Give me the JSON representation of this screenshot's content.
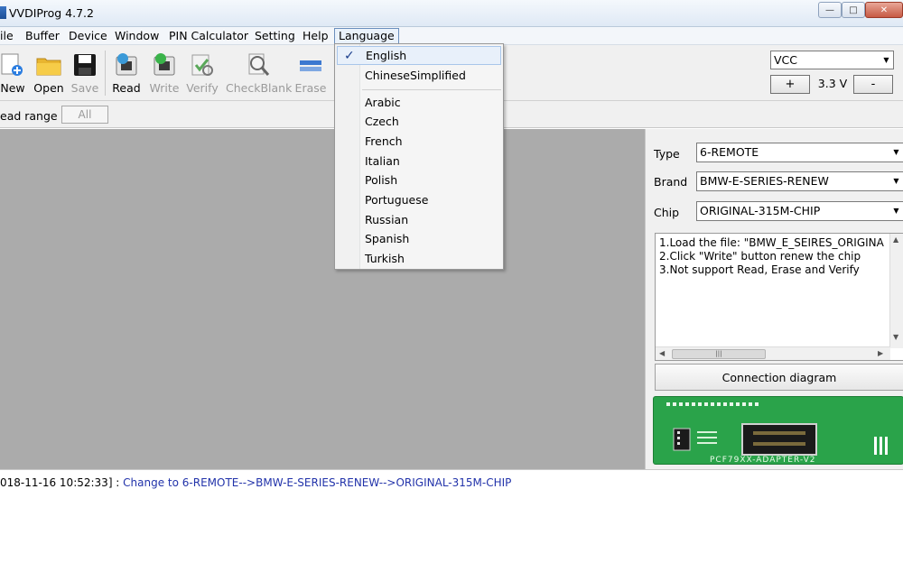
{
  "window": {
    "title": "VVDIProg 4.7.2",
    "min_glyph": "—",
    "max_glyph": "□",
    "close_glyph": "✕"
  },
  "menu": [
    "ile",
    "Buffer",
    "Device",
    "Window",
    "PIN Calculator",
    "Setting",
    "Help",
    "Language"
  ],
  "toolbar": {
    "new": "New",
    "open": "Open",
    "save": "Save",
    "read": "Read",
    "write": "Write",
    "verify": "Verify",
    "check_blank": "CheckBlank",
    "erase": "Erase"
  },
  "vcc": {
    "selected": "VCC",
    "plus": "+",
    "value": "3.3 V",
    "minus": "-"
  },
  "range": {
    "label": "ead range",
    "value": "All"
  },
  "config": {
    "type_label": "Type",
    "type_value": "6-REMOTE",
    "brand_label": "Brand",
    "brand_value": "BMW-E-SERIES-RENEW",
    "chip_label": "Chip",
    "chip_value": "ORIGINAL-315M-CHIP"
  },
  "notes": [
    "1.Load the file: \"BMW_E_SEIRES_ORIGINA",
    "2.Click \"Write\" button renew the chip",
    "3.Not support Read, Erase and Verify"
  ],
  "connection_button": "Connection diagram",
  "board_label": "PCF79XX-ADAPTER-V2",
  "log": {
    "time": "018-11-16 10:52:33] : ",
    "message": "Change to 6-REMOTE-->BMW-E-SERIES-RENEW-->ORIGINAL-315M-CHIP"
  },
  "language_menu": {
    "check": "✓",
    "top": [
      "English",
      "ChineseSimplified"
    ],
    "others": [
      "Arabic",
      "Czech",
      "French",
      "Italian",
      "Polish",
      "Portuguese",
      "Russian",
      "Spanish",
      "Turkish"
    ]
  },
  "colors": {
    "workspace": "#ababab",
    "board_green": "#2aa34a",
    "log_blue": "#2233aa"
  }
}
